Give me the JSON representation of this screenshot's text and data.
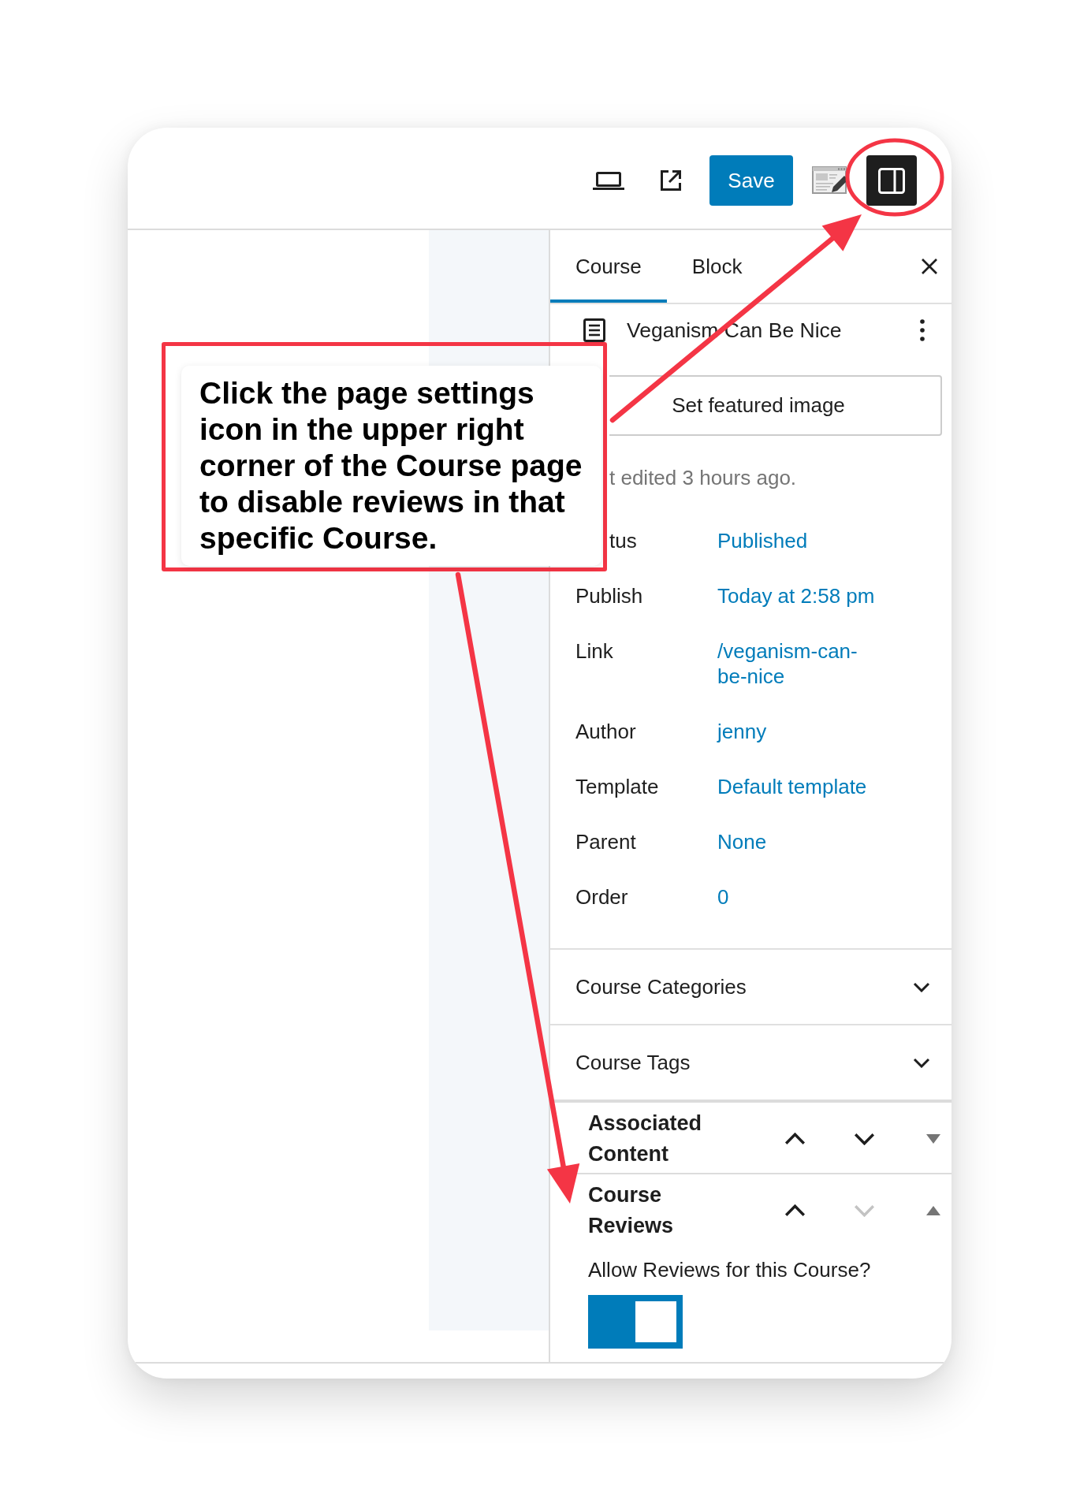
{
  "toolbar": {
    "save_label": "Save",
    "settings_active": true
  },
  "sidebar": {
    "tabs": [
      {
        "label": "Course",
        "selected": true
      },
      {
        "label": "Block",
        "selected": false
      }
    ],
    "post": {
      "title": "Veganism Can Be Nice",
      "featured_image_label": "Set featured image",
      "last_edited": "t edited 3 hours ago."
    },
    "fields": [
      {
        "kind": "partly_hidden",
        "label": "tus",
        "value": "Published"
      },
      {
        "kind": "plain",
        "label": "Publish",
        "value": "Today at 2:58 pm"
      },
      {
        "kind": "plain",
        "label": "Link",
        "value": "/veganism-can-be-nice"
      },
      {
        "kind": "plain",
        "label": "Author",
        "value": "jenny"
      },
      {
        "kind": "plain",
        "label": "Template",
        "value": "Default template"
      },
      {
        "kind": "plain",
        "label": "Parent",
        "value": "None"
      },
      {
        "kind": "plain",
        "label": "Order",
        "value": "0"
      }
    ],
    "panels": [
      {
        "title": "Course Categories",
        "expanded": false
      },
      {
        "title": "Course Tags",
        "expanded": false
      }
    ],
    "metaboxes": [
      {
        "title": "Associated Content",
        "expanded": false,
        "move_up_disabled": false,
        "move_down_disabled": false
      },
      {
        "title": "Course Reviews",
        "expanded": true,
        "move_up_disabled": false,
        "move_down_disabled": true,
        "setting": {
          "label": "Allow Reviews for this Course?",
          "on": true
        }
      }
    ]
  },
  "callout": {
    "text": "Click the page settings icon in the upper right corner of the Course page to disable reviews in that specific Course."
  }
}
